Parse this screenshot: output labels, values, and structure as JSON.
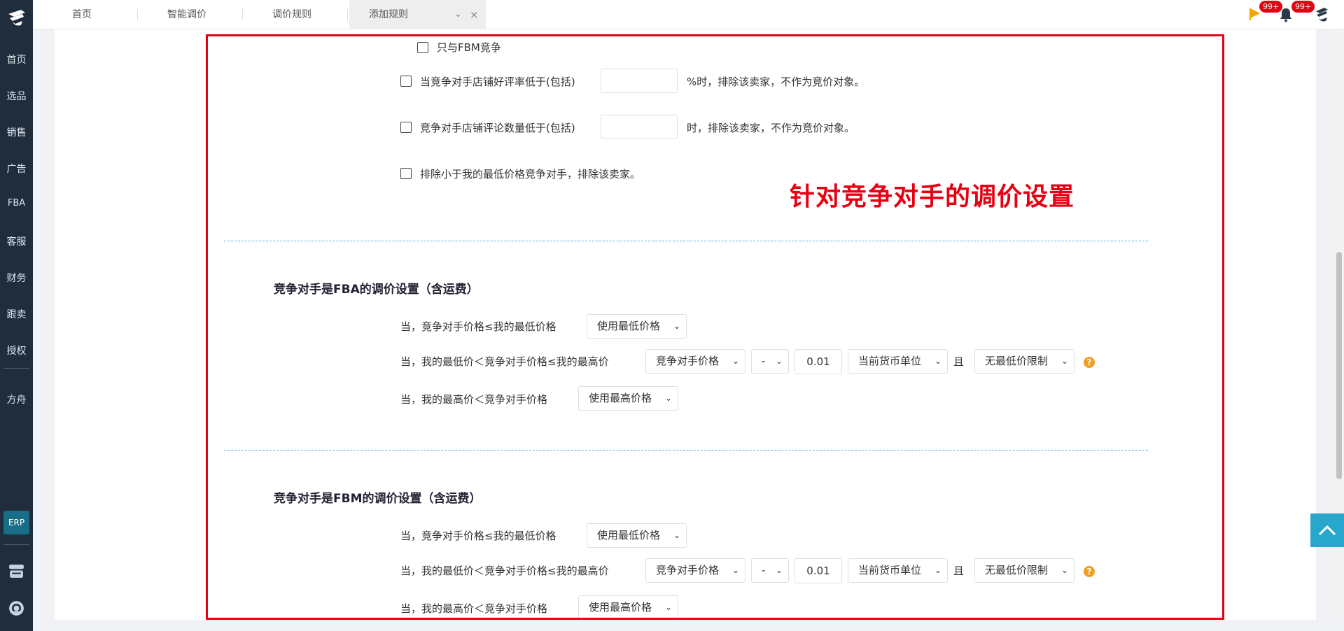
{
  "sidebar": {
    "items": [
      {
        "label": "首页",
        "name": "sidebar-item-home"
      },
      {
        "label": "选品",
        "name": "sidebar-item-product-selection"
      },
      {
        "label": "销售",
        "name": "sidebar-item-sales"
      },
      {
        "label": "广告",
        "name": "sidebar-item-ads"
      },
      {
        "label": "FBA",
        "name": "sidebar-item-fba"
      },
      {
        "label": "客服",
        "name": "sidebar-item-customer-service"
      },
      {
        "label": "财务",
        "name": "sidebar-item-finance"
      },
      {
        "label": "跟卖",
        "name": "sidebar-item-follow-sell"
      },
      {
        "label": "授权",
        "name": "sidebar-item-authorization"
      },
      {
        "label": "方舟",
        "name": "sidebar-item-ark"
      }
    ],
    "erp_label": "ERP"
  },
  "tabs": [
    {
      "label": "首页"
    },
    {
      "label": "智能调价"
    },
    {
      "label": "调价规则"
    },
    {
      "label": "添加规则"
    }
  ],
  "header": {
    "badge_flag": "99+",
    "badge_bell": "99+"
  },
  "filters": {
    "fbm_only": "只与FBM竞争",
    "rating_prefix": "当竞争对手店铺好评率低于(包括)",
    "rating_suffix": "%时，排除该卖家，不作为竞价对象。",
    "rating_value": "",
    "reviews_prefix": "竞争对手店铺评论数量低于(包括)",
    "reviews_suffix": "时，排除该卖家，不作为竞价对象。",
    "reviews_value": "",
    "exclude_lower": "排除小于我的最低价格竞争对手，排除该卖家。"
  },
  "annotation": "针对竞争对手的调价设置",
  "fba_section": {
    "title": "竞争对手是FBA的调价设置（含运费）",
    "rule1": "当，竞争对手价格≤我的最低价格",
    "rule1_select": "使用最低价格",
    "rule2": "当，我的最低价＜竞争对手价格≤我的最高价",
    "rule2_base": "竞争对手价格",
    "rule2_op": "-",
    "rule2_amount": "0.01",
    "rule2_unit": "当前货币单位",
    "rule2_and": "且",
    "rule2_limit": "无最低价限制",
    "rule3": "当，我的最高价＜竞争对手价格",
    "rule3_select": "使用最高价格"
  },
  "fbm_section": {
    "title": "竞争对手是FBM的调价设置（含运费）",
    "rule1": "当，竞争对手价格≤我的最低价格",
    "rule1_select": "使用最低价格",
    "rule2": "当，我的最低价＜竞争对手价格≤我的最高价",
    "rule2_base": "竞争对手价格",
    "rule2_op": "-",
    "rule2_amount": "0.01",
    "rule2_unit": "当前货币单位",
    "rule2_and": "且",
    "rule2_limit": "无最低价限制",
    "rule3": "当，我的最高价＜竞争对手价格",
    "rule3_select": "使用最高价格"
  },
  "colors": {
    "sidebar_bg": "#1f2d3d",
    "annotation_red": "#e60012",
    "accent_teal": "#28a7cc",
    "help_orange": "#f0a020"
  }
}
